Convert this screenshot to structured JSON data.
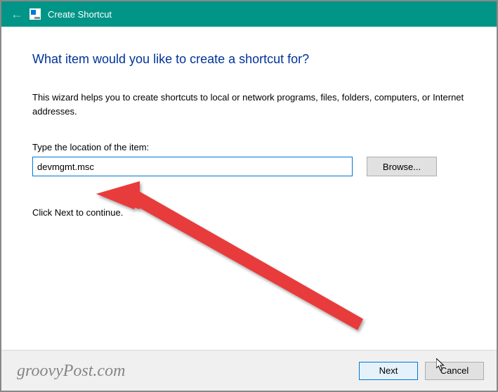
{
  "titlebar": {
    "title": "Create Shortcut"
  },
  "wizard": {
    "heading": "What item would you like to create a shortcut for?",
    "description": "This wizard helps you to create shortcuts to local or network programs, files, folders, computers, or Internet addresses.",
    "field_label": "Type the location of the item:",
    "location_value": "devmgmt.msc",
    "browse_label": "Browse...",
    "help_text": "Click Next to continue."
  },
  "footer": {
    "next_label": "Next",
    "cancel_label": "Cancel"
  },
  "watermark": "groovyPost.com"
}
